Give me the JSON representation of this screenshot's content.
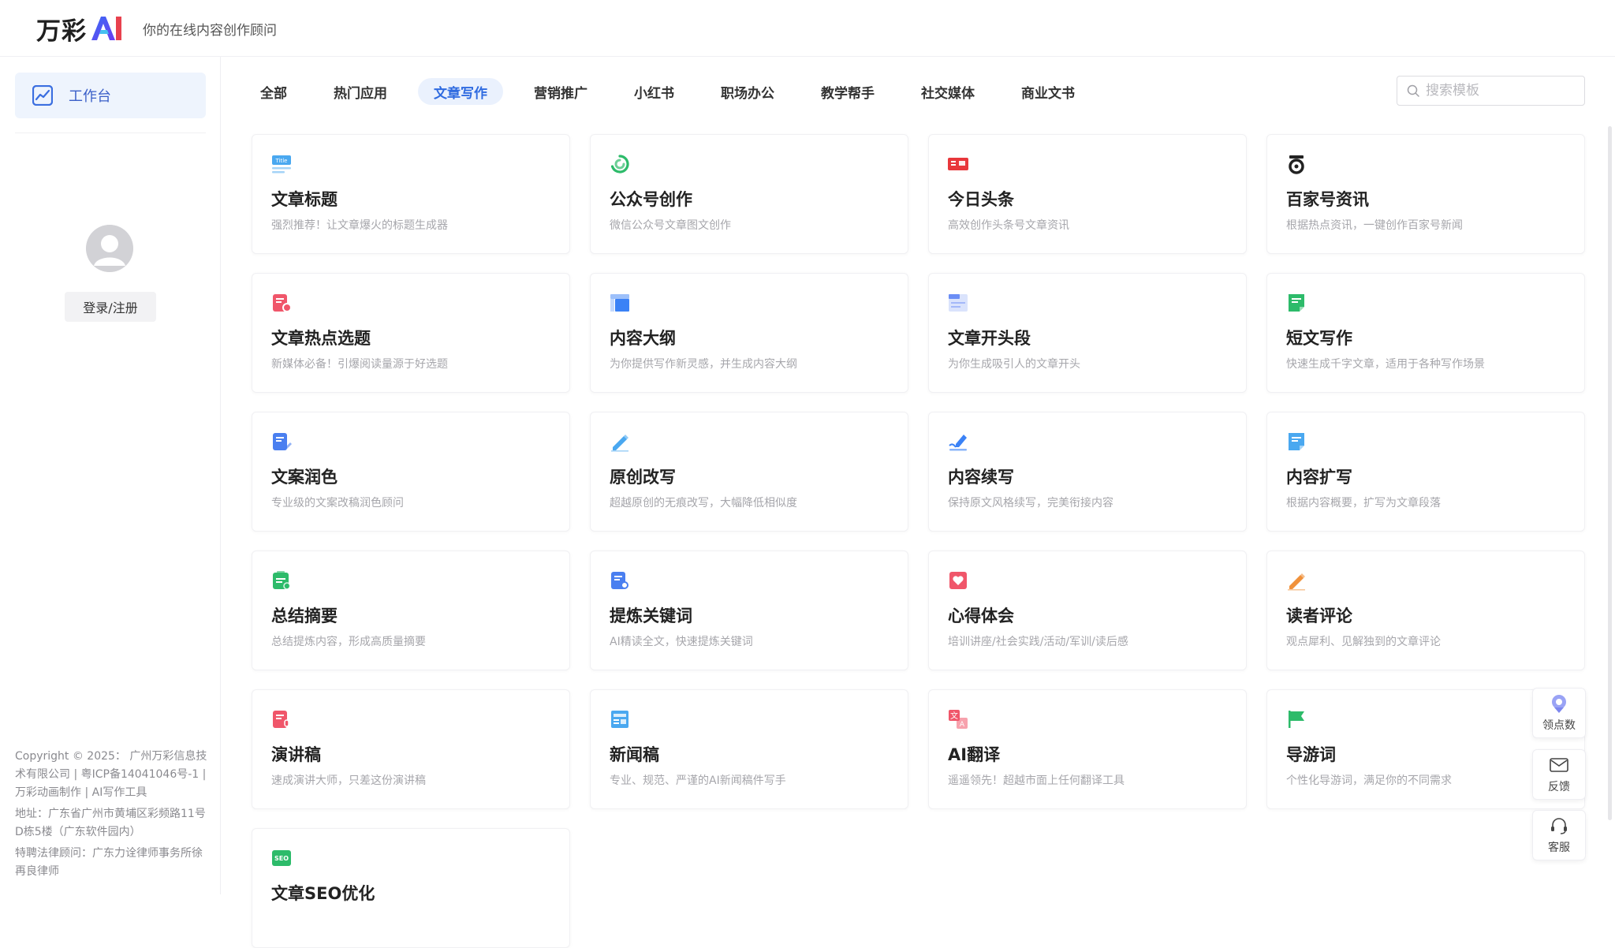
{
  "header": {
    "logo_text": "万彩",
    "slogan": "你的在线内容创作顾问"
  },
  "sidebar": {
    "workbench_label": "工作台",
    "login_label": "登录/注册",
    "footer": [
      "Copyright © 2025： 广州万彩信息技术有限公司 | 粤ICP备14041046号-1 | 万彩动画制作 | AI写作工具",
      "地址：广东省广州市黄埔区彩频路11号D栋5楼（广东软件园内）",
      "特聘法律顾问：广东力诠律师事务所徐再良律师"
    ]
  },
  "tabs": [
    {
      "label": "全部",
      "active": false
    },
    {
      "label": "热门应用",
      "active": false
    },
    {
      "label": "文章写作",
      "active": true
    },
    {
      "label": "营销推广",
      "active": false
    },
    {
      "label": "小红书",
      "active": false
    },
    {
      "label": "职场办公",
      "active": false
    },
    {
      "label": "教学帮手",
      "active": false
    },
    {
      "label": "社交媒体",
      "active": false
    },
    {
      "label": "商业文书",
      "active": false
    }
  ],
  "search": {
    "placeholder": "搜索模板"
  },
  "cards": [
    {
      "title": "文章标题",
      "desc": "强烈推荐！让文章爆火的标题生成器",
      "icon": "title-icon",
      "color": "#4aa8f0"
    },
    {
      "title": "公众号创作",
      "desc": "微信公众号文章图文创作",
      "icon": "wechat-icon",
      "color": "#2dbb6a"
    },
    {
      "title": "今日头条",
      "desc": "高效创作头条号文章资讯",
      "icon": "toutiao-icon",
      "color": "#e8373b"
    },
    {
      "title": "百家号资讯",
      "desc": "根据热点资讯，一键创作百家号新闻",
      "icon": "baijiahao-icon",
      "color": "#222222"
    },
    {
      "title": "文章热点选题",
      "desc": "新媒体必备！引爆阅读量源于好选题",
      "icon": "hot-topic-icon",
      "color": "#f0566a"
    },
    {
      "title": "内容大纲",
      "desc": "为你提供写作新灵感，并生成内容大纲",
      "icon": "outline-icon",
      "color": "#3b82f6"
    },
    {
      "title": "文章开头段",
      "desc": "为你生成吸引人的文章开头",
      "icon": "opening-icon",
      "color": "#6b8ef5"
    },
    {
      "title": "短文写作",
      "desc": "快速生成千字文章，适用于各种写作场景",
      "icon": "short-article-icon",
      "color": "#2dbb6a"
    },
    {
      "title": "文案润色",
      "desc": "专业级的文案改稿润色顾问",
      "icon": "polish-icon",
      "color": "#4a7ff0"
    },
    {
      "title": "原创改写",
      "desc": "超越原创的无痕改写，大幅降低相似度",
      "icon": "rewrite-pen-icon",
      "color": "#4aa8f0"
    },
    {
      "title": "内容续写",
      "desc": "保持原文风格续写，完美衔接内容",
      "icon": "continue-write-icon",
      "color": "#3b82f6"
    },
    {
      "title": "内容扩写",
      "desc": "根据内容概要，扩写为文章段落",
      "icon": "expand-icon",
      "color": "#4aa8f0"
    },
    {
      "title": "总结摘要",
      "desc": "总结提炼内容，形成高质量摘要",
      "icon": "summary-icon",
      "color": "#2dbb6a"
    },
    {
      "title": "提炼关键词",
      "desc": "AI精读全文，快速提炼关键词",
      "icon": "keyword-icon",
      "color": "#4a7ff0"
    },
    {
      "title": "心得体会",
      "desc": "培训讲座/社会实践/活动/军训/读后感",
      "icon": "heart-icon",
      "color": "#f0566a"
    },
    {
      "title": "读者评论",
      "desc": "观点犀利、见解独到的文章评论",
      "icon": "comment-pen-icon",
      "color": "#f0913a"
    },
    {
      "title": "演讲稿",
      "desc": "速成演讲大师，只差这份演讲稿",
      "icon": "speech-icon",
      "color": "#f0566a"
    },
    {
      "title": "新闻稿",
      "desc": "专业、规范、严谨的AI新闻稿件写手",
      "icon": "news-icon",
      "color": "#4aa8f0"
    },
    {
      "title": "AI翻译",
      "desc": "遥遥领先！超越市面上任何翻译工具",
      "icon": "translate-icon",
      "color": "#f0566a"
    },
    {
      "title": "导游词",
      "desc": "个性化导游词，满足你的不同需求",
      "icon": "flag-icon",
      "color": "#2dbb6a"
    },
    {
      "title": "文章SEO优化",
      "desc": "",
      "icon": "seo-icon",
      "color": "#2dbb6a"
    }
  ],
  "float_buttons": [
    {
      "label": "领点数",
      "icon": "reward-icon"
    },
    {
      "label": "反馈",
      "icon": "mail-icon"
    },
    {
      "label": "客服",
      "icon": "headset-icon"
    }
  ]
}
